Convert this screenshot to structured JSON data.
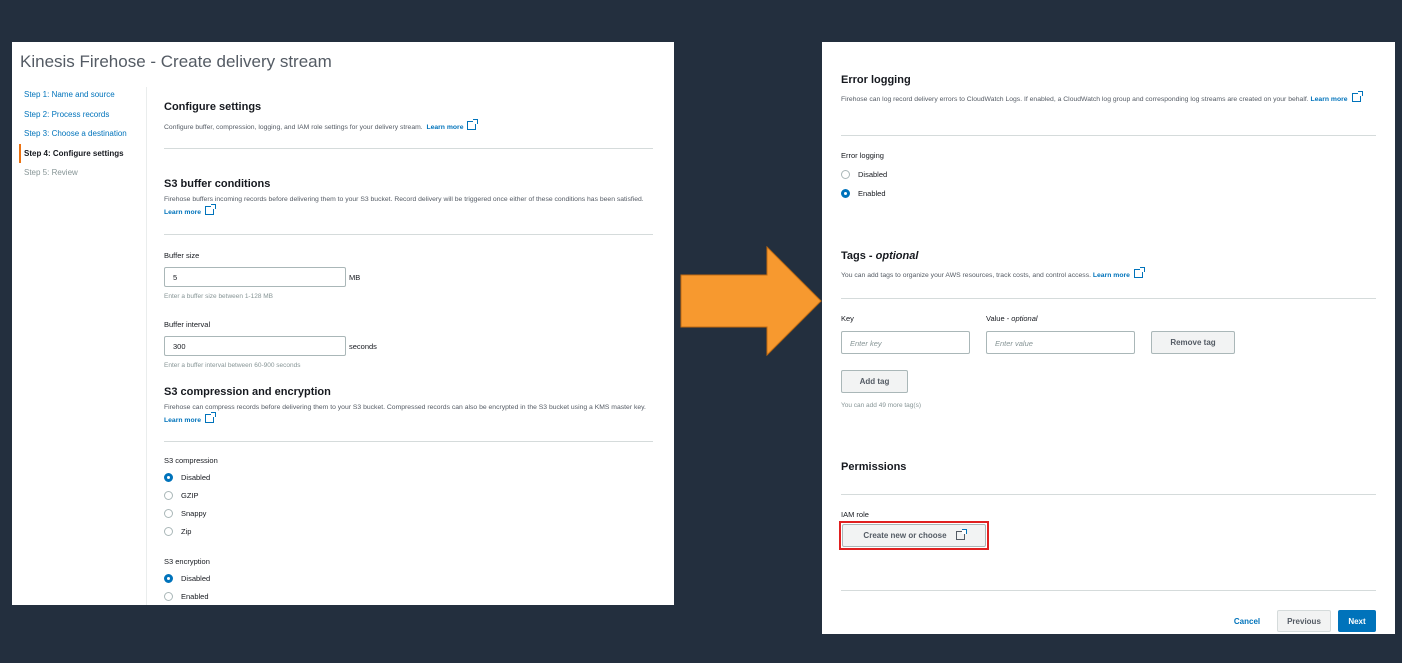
{
  "left": {
    "page_title": "Kinesis Firehose - Create delivery stream",
    "steps": [
      "Step 1: Name and source",
      "Step 2: Process records",
      "Step 3: Choose a destination",
      "Step 4: Configure settings",
      "Step 5: Review"
    ],
    "active_step": 3,
    "configure": {
      "title": "Configure settings",
      "desc": "Configure buffer, compression, logging, and IAM role settings for your delivery stream.",
      "learn_more": "Learn more"
    },
    "buffer": {
      "title": "S3 buffer conditions",
      "desc": "Firehose buffers incoming records before delivering them to your S3 bucket. Record delivery will be triggered once either of these conditions has been satisfied.",
      "learn_more": "Learn more",
      "size_label": "Buffer size",
      "size_value": "5",
      "size_unit": "MB",
      "size_hint": "Enter a buffer size between 1-128 MB",
      "interval_label": "Buffer interval",
      "interval_value": "300",
      "interval_unit": "seconds",
      "interval_hint": "Enter a buffer interval between 60-900 seconds"
    },
    "compression": {
      "title": "S3 compression and encryption",
      "desc": "Firehose can compress records before delivering them to your S3 bucket. Compressed records can also be encrypted in the S3 bucket using a KMS master key.",
      "learn_more": "Learn more",
      "compression_label": "S3 compression",
      "compression_options": [
        "Disabled",
        "GZIP",
        "Snappy",
        "Zip"
      ],
      "compression_selected": "Disabled",
      "encryption_label": "S3 encryption",
      "encryption_options": [
        "Disabled",
        "Enabled"
      ],
      "encryption_selected": "Disabled"
    }
  },
  "right": {
    "error_logging": {
      "title": "Error logging",
      "desc": "Firehose can log record delivery errors to CloudWatch Logs. If enabled, a CloudWatch log group and corresponding log streams are created on your behalf.",
      "learn_more": "Learn more",
      "field_label": "Error logging",
      "options": [
        "Disabled",
        "Enabled"
      ],
      "selected": "Enabled"
    },
    "tags": {
      "title": "Tags - ",
      "title_optional": "optional",
      "desc": "You can add tags to organize your AWS resources, track costs, and control access.",
      "learn_more": "Learn more",
      "key_label": "Key",
      "value_label": "Value - ",
      "value_optional": "optional",
      "key_placeholder": "Enter key",
      "value_placeholder": "Enter value",
      "remove_button": "Remove tag",
      "add_button": "Add tag",
      "remaining_hint": "You can add 49 more tag(s)"
    },
    "permissions": {
      "title": "Permissions",
      "iam_label": "IAM role",
      "iam_button": "Create new or choose"
    },
    "footer": {
      "cancel": "Cancel",
      "previous": "Previous",
      "next": "Next"
    }
  },
  "colors": {
    "background": "#232f3e",
    "link": "#0073bb",
    "arrow": "#f7992f",
    "highlight": "#e02020"
  }
}
